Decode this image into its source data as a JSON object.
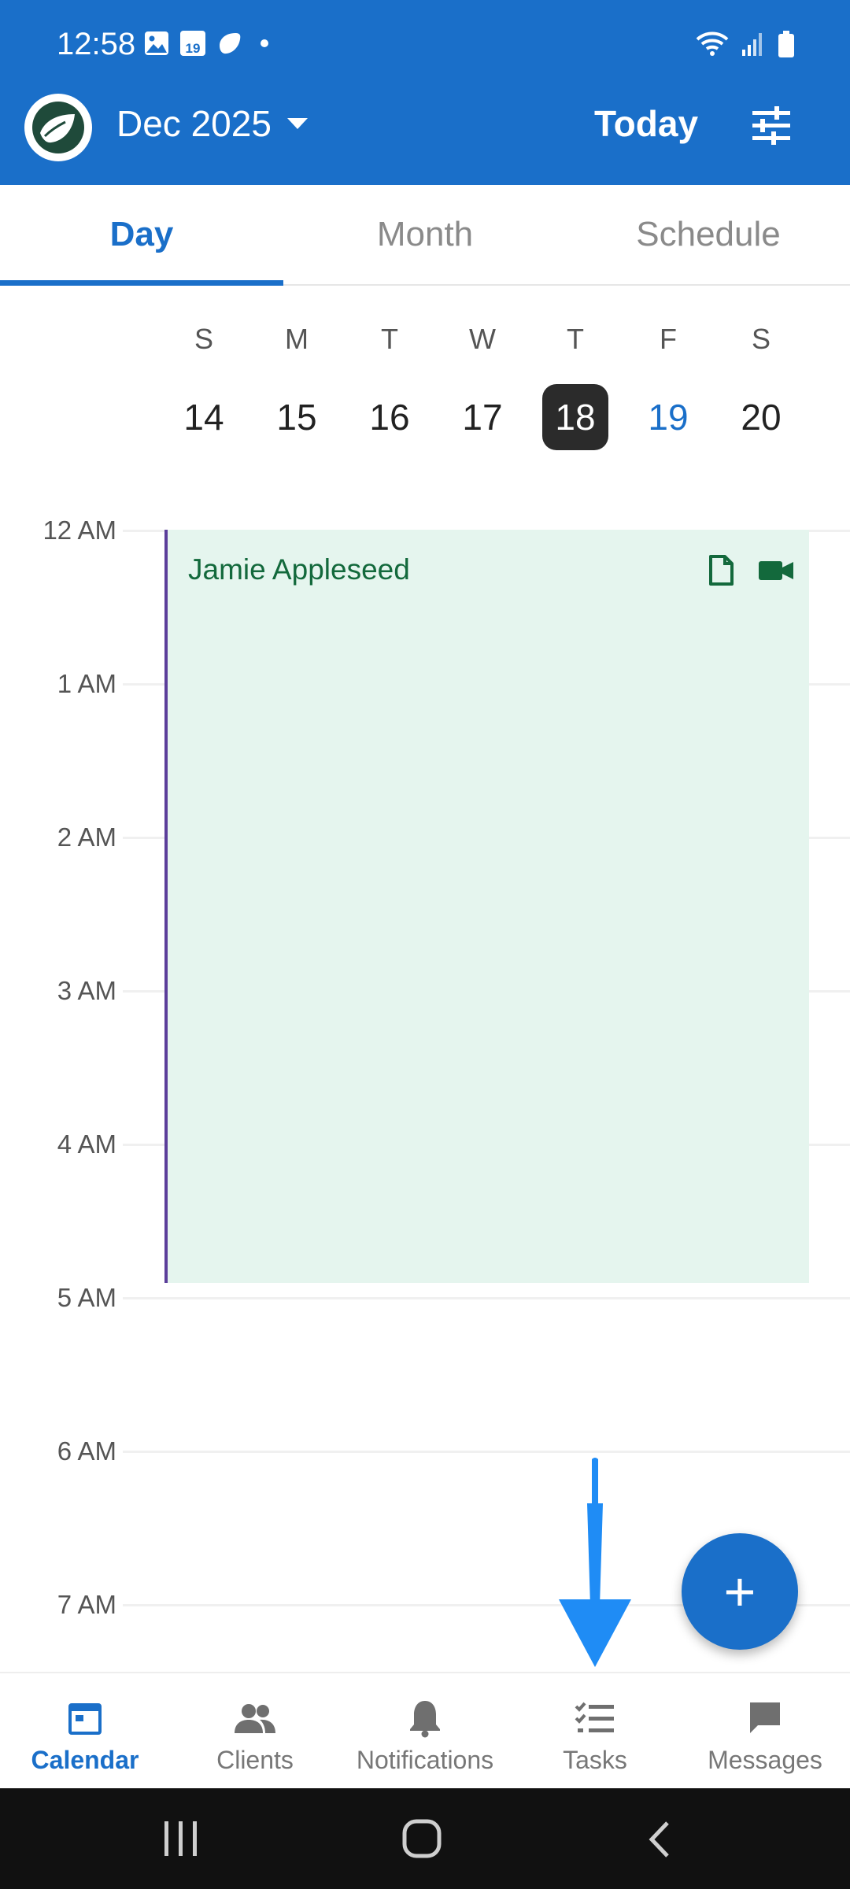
{
  "status_bar": {
    "time": "12:58",
    "calendar_icon_text": "19"
  },
  "header": {
    "month_label": "Dec 2025",
    "today_label": "Today"
  },
  "tabs": [
    {
      "label": "Day",
      "active": true
    },
    {
      "label": "Month",
      "active": false
    },
    {
      "label": "Schedule",
      "active": false
    }
  ],
  "week": [
    {
      "dow": "S",
      "date": "14"
    },
    {
      "dow": "M",
      "date": "15"
    },
    {
      "dow": "T",
      "date": "16"
    },
    {
      "dow": "W",
      "date": "17"
    },
    {
      "dow": "T",
      "date": "18",
      "selected": true
    },
    {
      "dow": "F",
      "date": "19",
      "highlight": true
    },
    {
      "dow": "S",
      "date": "20"
    }
  ],
  "timeline": {
    "hours": [
      "12 AM",
      "1 AM",
      "2 AM",
      "3 AM",
      "4 AM",
      "5 AM",
      "6 AM",
      "7 AM"
    ]
  },
  "event": {
    "title": "Jamie Appleseed"
  },
  "fab": {
    "symbol": "+"
  },
  "bottom_nav": [
    {
      "label": "Calendar",
      "icon": "calendar-icon",
      "active": true
    },
    {
      "label": "Clients",
      "icon": "people-icon"
    },
    {
      "label": "Notifications",
      "icon": "bell-icon"
    },
    {
      "label": "Tasks",
      "icon": "tasks-icon"
    },
    {
      "label": "Messages",
      "icon": "message-icon"
    }
  ],
  "colors": {
    "primary": "#1a6fc9",
    "event_bg": "#e5f5ee",
    "event_text": "#13693c",
    "pointer_arrow": "#1f8cf5"
  }
}
